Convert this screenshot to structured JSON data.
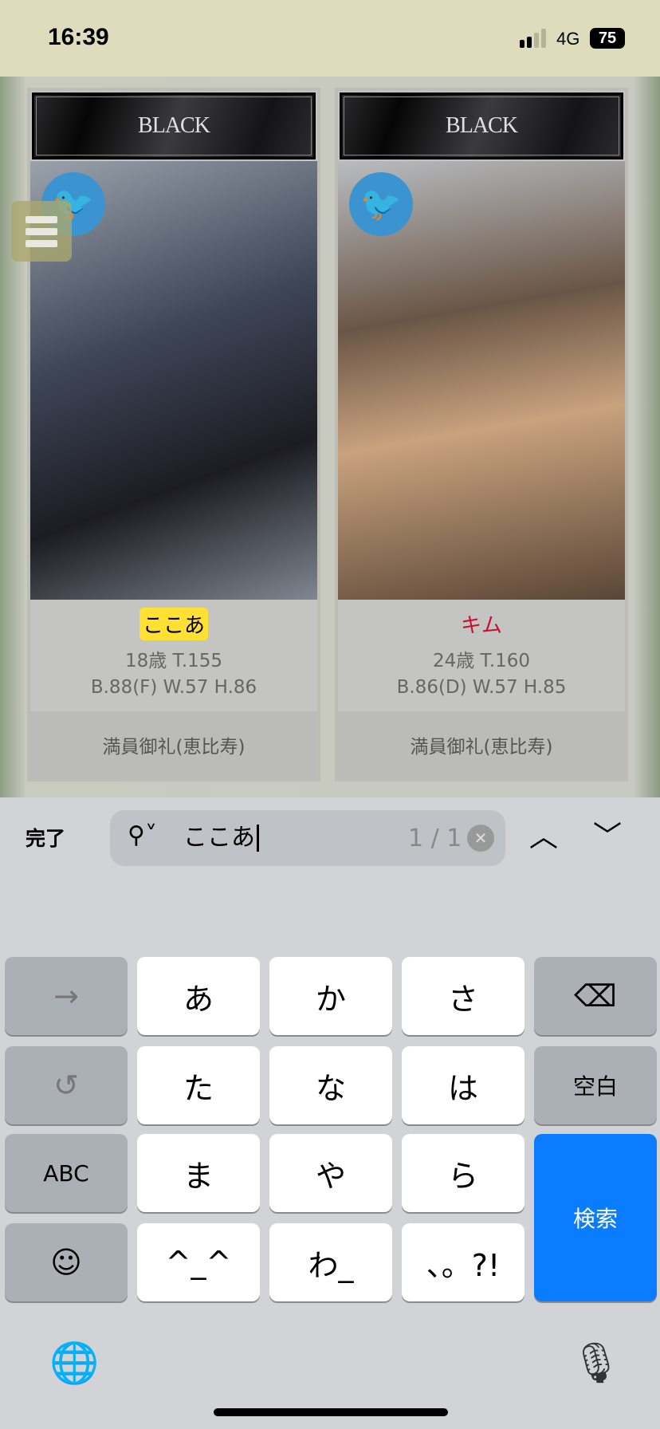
{
  "status": {
    "time": "16:39",
    "network": "4G",
    "battery": "75"
  },
  "menu_icon": "hamburger-icon",
  "cards": [
    {
      "badge": "BLACK",
      "name": "ここあ",
      "name_highlighted": true,
      "age_height": "18歳 T.155",
      "measurements": "B.88(F) W.57 H.86",
      "location": "満員御礼(恵比寿)",
      "social_icon": "twitter-icon"
    },
    {
      "badge": "BLACK",
      "name": "キム",
      "name_color": "#c8102e",
      "age_height": "24歳 T.160",
      "measurements": "B.86(D) W.57 H.85",
      "location": "満員御礼(恵比寿)",
      "social_icon": "twitter-icon"
    }
  ],
  "find_bar": {
    "done": "完了",
    "query": "ここあ",
    "count": "1 / 1"
  },
  "keyboard": {
    "rows": [
      [
        "→",
        "あ",
        "か",
        "さ",
        "⌫"
      ],
      [
        "↺",
        "た",
        "な",
        "は",
        "空白"
      ],
      [
        "ABC",
        "ま",
        "や",
        "ら",
        "検索"
      ],
      [
        "☺",
        "^_^",
        "わ_",
        "、。?!"
      ]
    ],
    "accent": "#0a7cff"
  },
  "highlight_color": "#ffe033"
}
